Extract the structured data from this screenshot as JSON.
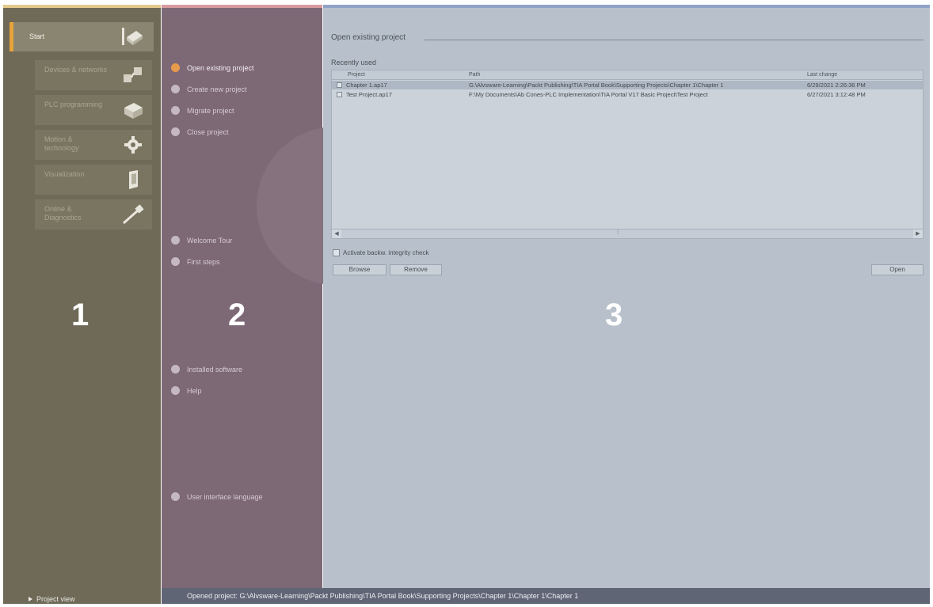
{
  "sidebar": {
    "start_label": "Start",
    "items": [
      {
        "label": "Devices & networks",
        "icon": "devices-networks-icon"
      },
      {
        "label": "PLC programming",
        "icon": "plc-programming-icon"
      },
      {
        "label": "Motion & technology",
        "icon": "gear-icon"
      },
      {
        "label": "Visualization",
        "icon": "visualization-icon"
      },
      {
        "label": "Online & Diagnostics",
        "icon": "diagnostics-probe-icon"
      }
    ],
    "project_view_label": "Project view"
  },
  "actions": {
    "items": [
      {
        "label": "Open existing project"
      },
      {
        "label": "Create new project"
      },
      {
        "label": "Migrate project"
      },
      {
        "label": "Close project"
      },
      {
        "label": "Welcome Tour"
      },
      {
        "label": "First steps"
      },
      {
        "label": "Installed software"
      },
      {
        "label": "Help"
      },
      {
        "label": "User interface language"
      }
    ]
  },
  "main": {
    "title": "Open existing project",
    "recent_label": "Recently used",
    "columns": [
      "Project",
      "Path",
      "Last change"
    ],
    "rows": [
      {
        "project": "Chapter 1.ap17",
        "path": "G:\\Alvsware-Learning\\Packt Publishing\\TIA Portal Book\\Supporting Projects\\Chapter 1\\Chapter 1",
        "last_change": "6/29/2021 2:26:36 PM"
      },
      {
        "project": "Test Project.ap17",
        "path": "F:\\My Documents\\Ab Cones-PLC Implementation\\TIA Portal V17 Basic Project\\Test Project",
        "last_change": "6/27/2021 3:12:48 PM"
      }
    ],
    "activate_check_label": "Activate backw. integrity check",
    "browse_label": "Browse",
    "remove_label": "Remove",
    "open_label": "Open"
  },
  "status": {
    "opened_project": "Opened project:   G:\\Alvsware-Learning\\Packt Publishing\\TIA Portal Book\\Supporting Projects\\Chapter 1\\Chapter 1\\Chapter 1"
  },
  "labels": {
    "panel1": "1",
    "panel2": "2",
    "panel3": "3"
  },
  "colors": {
    "panel1_bg": "#6e6a57",
    "panel2_bg": "#7d6876",
    "panel3_bg": "#b8c1cb",
    "accent_orange": "#e6a33a"
  }
}
